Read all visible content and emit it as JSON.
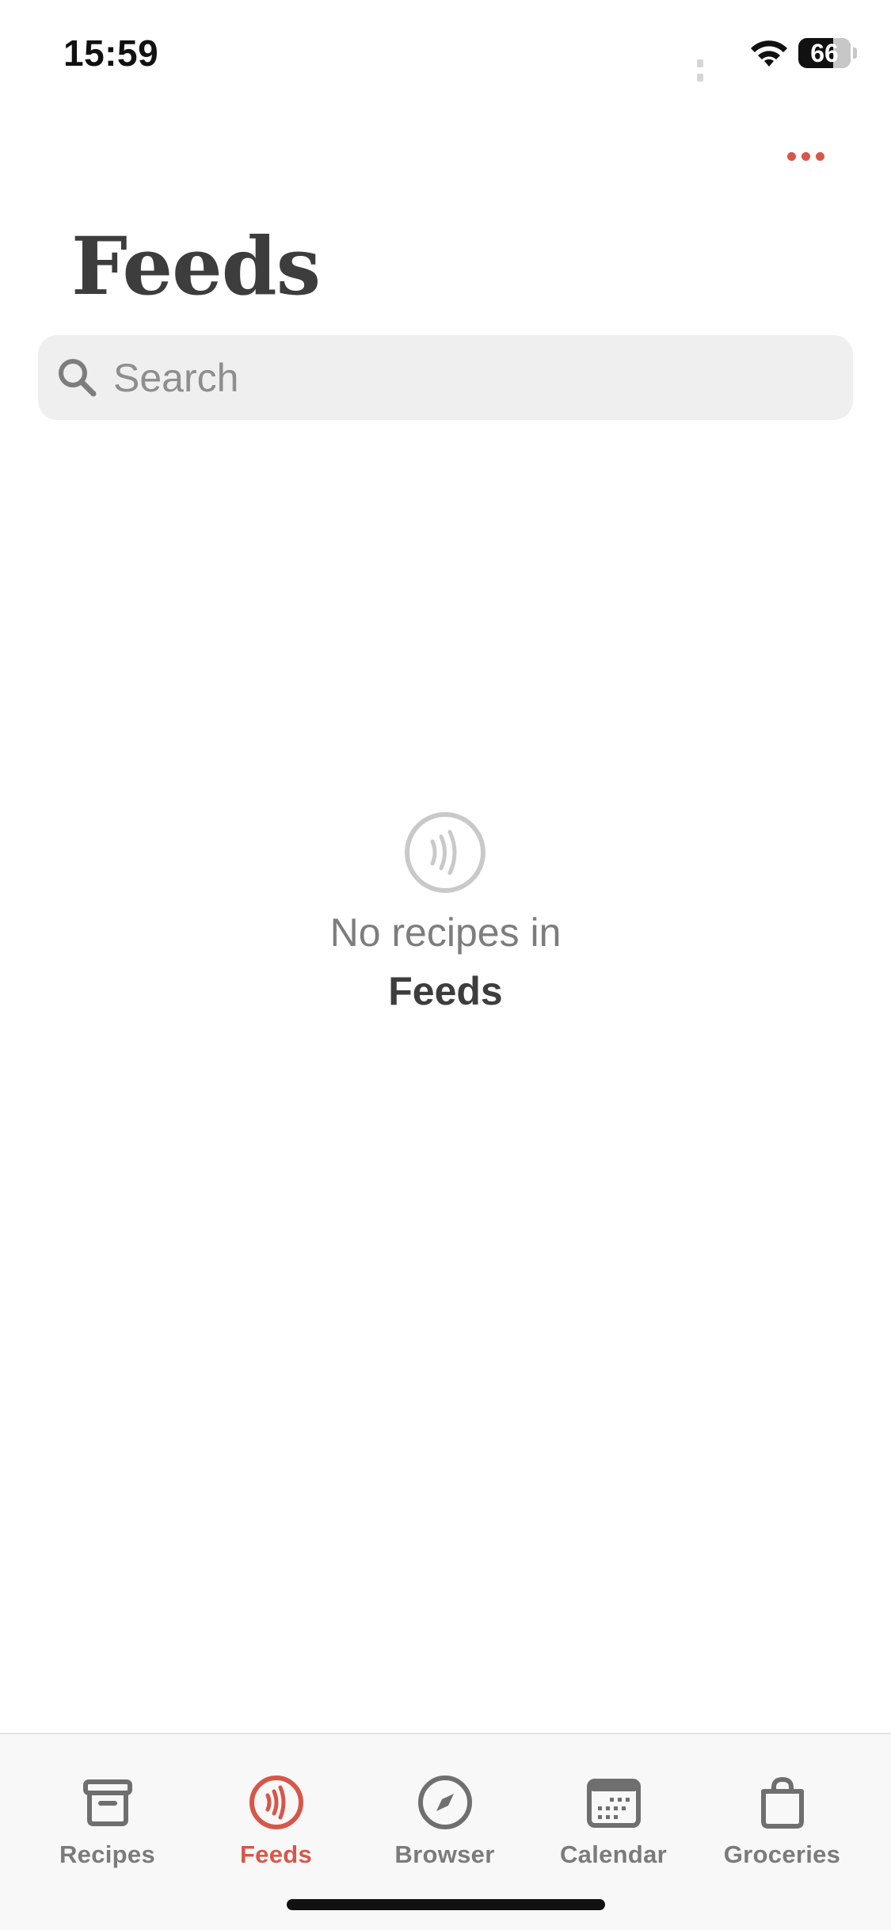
{
  "status_bar": {
    "time": "15:59",
    "battery": "66",
    "icons": [
      "signal-icon",
      "wifi-icon",
      "battery-icon"
    ]
  },
  "header": {
    "more_icon": "ellipsis-icon",
    "title": "Feeds"
  },
  "search": {
    "placeholder": "Search",
    "icon": "search-icon"
  },
  "empty_state": {
    "icon": "feed-icon",
    "line1": "No recipes in",
    "line2": "Feeds"
  },
  "tab_bar": {
    "tabs": [
      {
        "label": "Recipes",
        "icon": "archive-box-icon",
        "active": false
      },
      {
        "label": "Feeds",
        "icon": "feed-icon",
        "active": true
      },
      {
        "label": "Browser",
        "icon": "compass-icon",
        "active": false
      },
      {
        "label": "Calendar",
        "icon": "calendar-icon",
        "active": false
      },
      {
        "label": "Groceries",
        "icon": "shopping-bag-icon",
        "active": false
      }
    ]
  },
  "colors": {
    "accent": "#d6574a",
    "text": "#3d3d3d",
    "muted": "#7b7b7b",
    "search_bg": "#efefef",
    "tab_bar_bg": "#f8f8f8"
  }
}
